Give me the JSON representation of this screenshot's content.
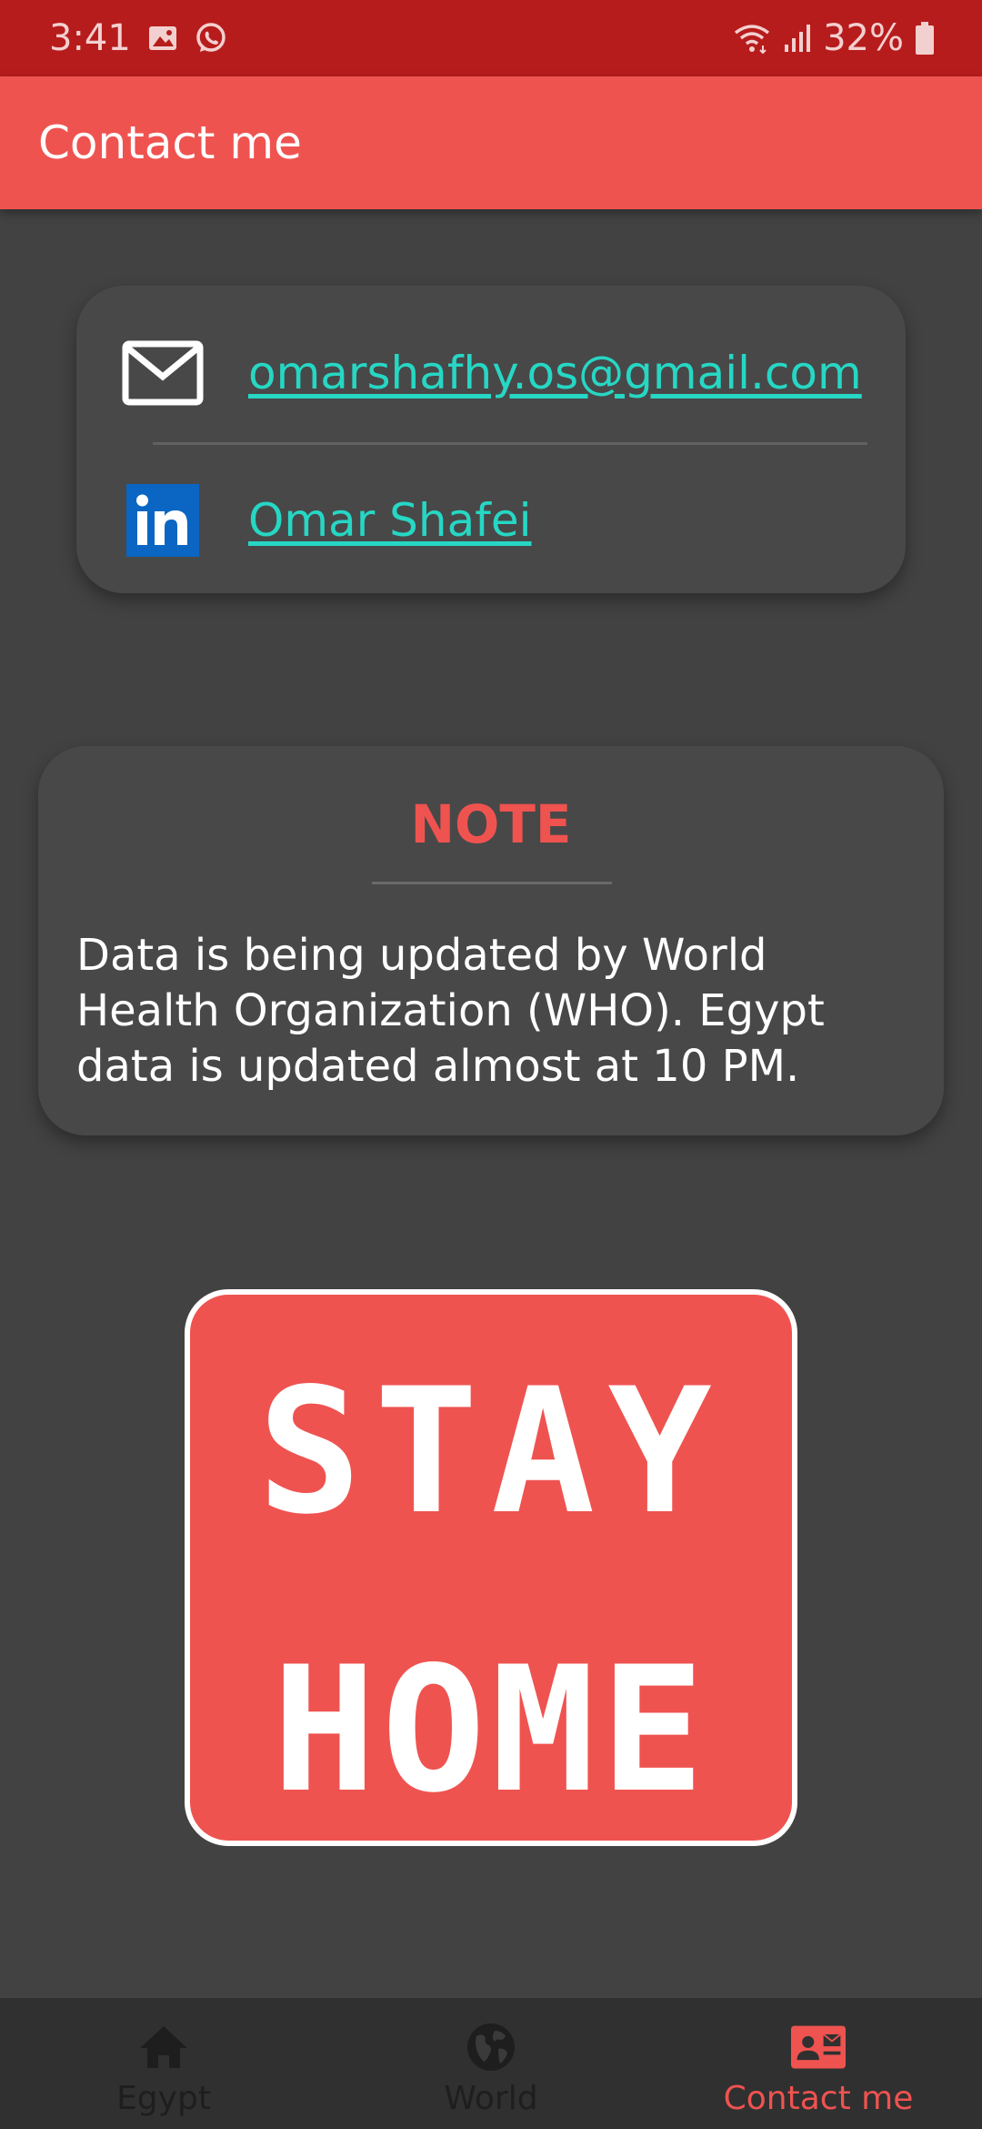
{
  "status_bar": {
    "time": "3:41",
    "battery_percent": "32%",
    "left_icons": [
      "gallery-icon",
      "whatsapp-icon"
    ],
    "right_icons": [
      "wifi-icon",
      "signal-icon",
      "battery-icon"
    ]
  },
  "app_bar": {
    "title": "Contact me"
  },
  "contact": {
    "email_icon": "mail-icon",
    "email": "omarshafhy.os@gmail.com",
    "linkedin_icon": "linkedin-icon",
    "linkedin_name": "Omar Shafei"
  },
  "note": {
    "title": "NOTE",
    "text": "Data is being updated by World Health Organization (WHO). Egypt data is updated almost at 10 PM."
  },
  "stay_home": {
    "line1": "STAY",
    "line2": "HOME"
  },
  "bottom_nav": {
    "items": [
      {
        "label": "Egypt",
        "icon": "home-icon",
        "active": false
      },
      {
        "label": "World",
        "icon": "globe-icon",
        "active": false
      },
      {
        "label": "Contact me",
        "icon": "contact-card-icon",
        "active": true
      }
    ]
  },
  "colors": {
    "status_bar": "#b71c1c",
    "app_bar": "#ef5350",
    "background": "#424242",
    "card": "#484848",
    "link": "#26d7c4",
    "accent": "#ef5350",
    "nav_bar": "#303030"
  }
}
